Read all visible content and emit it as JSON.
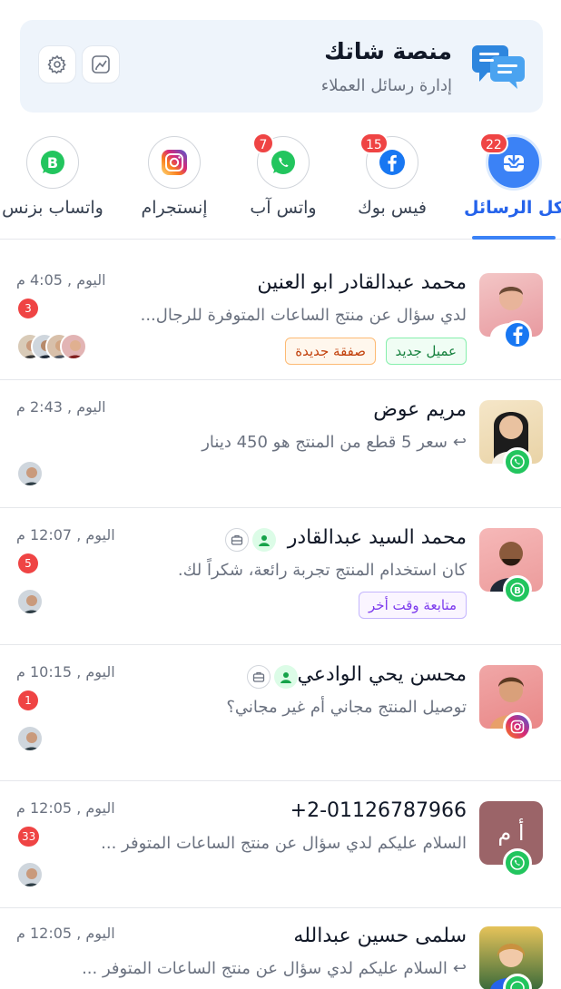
{
  "header": {
    "title": "منصة شاتك",
    "subtitle": "إدارة رسائل العملاء",
    "logo_icon": "chat-bubbles-icon",
    "settings_icon": "gear-icon",
    "stats_icon": "chart-icon"
  },
  "tabs": [
    {
      "label": "كل الرسائل",
      "badge": "22",
      "icon": "inbox-icon",
      "active": true
    },
    {
      "label": "فيس بوك",
      "badge": "15",
      "icon": "facebook-icon"
    },
    {
      "label": "واتس آب",
      "badge": "7",
      "icon": "whatsapp-icon"
    },
    {
      "label": "إنستجرام",
      "badge": "",
      "icon": "instagram-icon"
    },
    {
      "label": "واتساب بزنس",
      "badge": "",
      "icon": "whatsapp-business-icon"
    }
  ],
  "conversations": [
    {
      "name": "محمد عبدالقادر ابو العنين",
      "preview": "لدي سؤال عن منتج الساعات المتوفرة للرجال...",
      "time": "اليوم , 4:05 م",
      "unread": "3",
      "channel": "facebook",
      "tags": [
        "عميل جديد",
        "صفقة جديدة"
      ]
    },
    {
      "name": "مريم عوض",
      "preview": "سعر 5 قطع من المنتج هو 450 دينار",
      "time": "اليوم , 2:43 م",
      "unread": "",
      "channel": "whatsapp",
      "tags": []
    },
    {
      "name": "محمد السيد عبدالقادر",
      "preview": "كان استخدام المنتج تجربة رائعة، شكراً لك.",
      "time": "اليوم , 12:07 م",
      "unread": "5",
      "channel": "whatsapp-business",
      "tags": [
        "متابعة وقت أخر"
      ]
    },
    {
      "name": "محسن يحي الوادعي",
      "preview": "توصيل المنتج مجاني أم غير مجاني؟",
      "time": "اليوم , 10:15 م",
      "unread": "1",
      "channel": "instagram",
      "tags": []
    },
    {
      "name": "+2-01126787966",
      "preview": "السلام عليكم لدي سؤال عن منتج الساعات المتوفر ...",
      "time": "اليوم , 12:05 م",
      "unread": "33",
      "channel": "whatsapp",
      "avatar_initials": "أ م",
      "tags": []
    },
    {
      "name": "سلمى حسين عبدالله",
      "preview": "السلام عليكم لدي سؤال عن منتج الساعات المتوفر ...",
      "time": "اليوم , 12:05 م",
      "unread": "",
      "channel": "whatsapp",
      "tags": []
    }
  ],
  "colors": {
    "accent": "#3b82f6",
    "badge_red": "#ef4444",
    "whatsapp": "#22c55e",
    "facebook": "#1877f2"
  }
}
